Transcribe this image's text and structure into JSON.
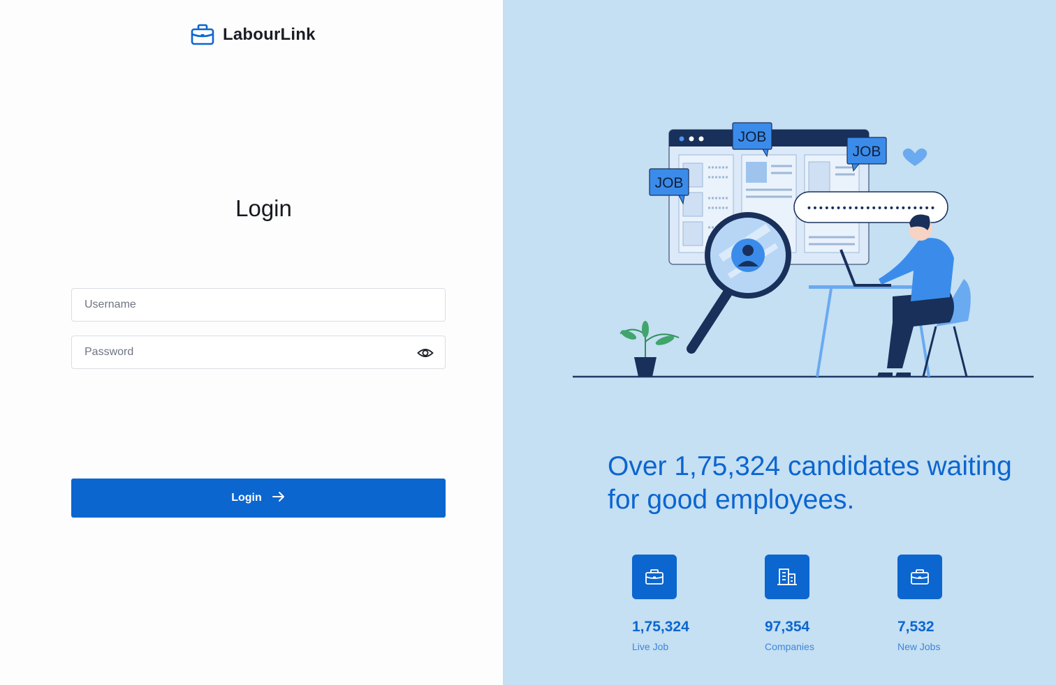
{
  "app": {
    "name": "LabourLink",
    "logo_icon": "briefcase-icon",
    "accent_color": "#0b66cf",
    "panel_color": "#c5dff3"
  },
  "login": {
    "title": "Login",
    "username_placeholder": "Username",
    "username_value": "",
    "password_placeholder": "Password",
    "password_value": "",
    "password_toggle_icon": "eye-icon",
    "submit_label": "Login",
    "submit_icon": "arrow-right-icon"
  },
  "promo": {
    "illustration_labels": [
      "JOB",
      "JOB",
      "JOB"
    ],
    "password_bubble": "••••••••••••••••••••••",
    "headline": "Over 1,75,324 candidates waiting for good employees.",
    "stats": [
      {
        "icon": "briefcase-icon",
        "value": "1,75,324",
        "label": "Live Job"
      },
      {
        "icon": "building-icon",
        "value": "97,354",
        "label": "Companies"
      },
      {
        "icon": "briefcase-icon",
        "value": "7,532",
        "label": "New Jobs"
      }
    ]
  }
}
